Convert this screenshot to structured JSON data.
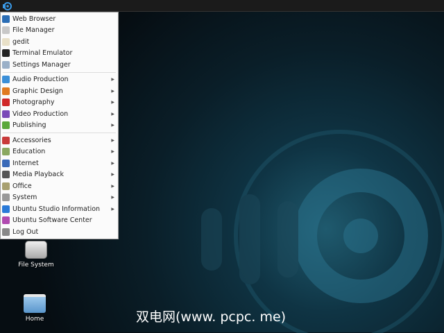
{
  "taskbar": {
    "app_menu_icon": "ubuntu-studio-logo-icon"
  },
  "menu": {
    "group1": [
      {
        "label": "Web Browser",
        "icon": "globe-icon",
        "color": "#2a6db5"
      },
      {
        "label": "File Manager",
        "icon": "folder-icon",
        "color": "#c8c8c8"
      },
      {
        "label": "gedit",
        "icon": "text-editor-icon",
        "color": "#e8e0c8"
      },
      {
        "label": "Terminal Emulator",
        "icon": "terminal-icon",
        "color": "#222222"
      },
      {
        "label": "Settings Manager",
        "icon": "settings-icon",
        "color": "#9ab0c8"
      }
    ],
    "group2": [
      {
        "label": "Audio Production",
        "icon": "audio-icon",
        "color": "#3b8fd8"
      },
      {
        "label": "Graphic Design",
        "icon": "graphic-design-icon",
        "color": "#e07a20"
      },
      {
        "label": "Photography",
        "icon": "photography-icon",
        "color": "#d02828"
      },
      {
        "label": "Video Production",
        "icon": "video-icon",
        "color": "#7a4ab8"
      },
      {
        "label": "Publishing",
        "icon": "publishing-icon",
        "color": "#5aa83a"
      }
    ],
    "group3": [
      {
        "label": "Accessories",
        "icon": "accessories-icon",
        "color": "#c83a3a",
        "sub": true
      },
      {
        "label": "Education",
        "icon": "education-icon",
        "color": "#8aa860",
        "sub": true
      },
      {
        "label": "Internet",
        "icon": "internet-icon",
        "color": "#3a6ab8",
        "sub": true
      },
      {
        "label": "Media Playback",
        "icon": "media-icon",
        "color": "#555555",
        "sub": true
      },
      {
        "label": "Office",
        "icon": "office-icon",
        "color": "#a8a070",
        "sub": true
      },
      {
        "label": "System",
        "icon": "system-icon",
        "color": "#999999",
        "sub": true
      },
      {
        "label": "Ubuntu Studio Information",
        "icon": "ubuntu-studio-icon",
        "color": "#2a7ad8",
        "sub": true
      },
      {
        "label": "Ubuntu Software Center",
        "icon": "software-center-icon",
        "color": "#b04ab0",
        "sub": false
      },
      {
        "label": "Log Out",
        "icon": "logout-icon",
        "color": "#888888",
        "sub": false
      }
    ]
  },
  "desktop": [
    {
      "label": "File System"
    },
    {
      "label": "Home"
    }
  ],
  "watermark": "双电网(www. pcpc. me)"
}
